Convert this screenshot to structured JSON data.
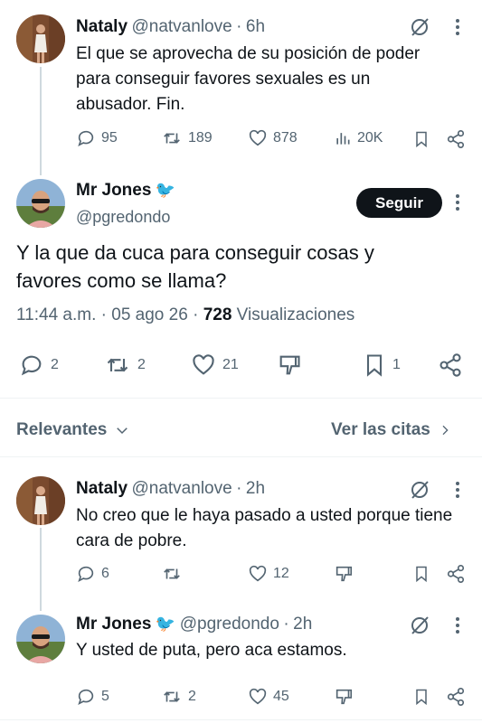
{
  "tweet1": {
    "name": "Nataly",
    "handle": "@natvanlove",
    "time": "6h",
    "text": "El que se aprovecha de su posición de poder para conseguir favores sexuales es un abusador. Fin.",
    "replies": "95",
    "retweets": "189",
    "likes": "878",
    "views": "20K"
  },
  "main_tweet": {
    "name": "Mr Jones",
    "name_emoji": "🐦",
    "handle": "@pgredondo",
    "follow_label": "Seguir",
    "text": "Y la que da cuca para conseguir cosas y favores como se llama?",
    "time": "11:44 a.m.",
    "date": "05 ago 26",
    "views_count": "728",
    "views_label": "Visualizaciones",
    "replies": "2",
    "retweets": "2",
    "likes": "21",
    "bookmarks": "1"
  },
  "replies_header": {
    "sort_label": "Relevantes",
    "quotes_label": "Ver las citas"
  },
  "reply1": {
    "name": "Nataly",
    "handle": "@natvanlove",
    "time": "2h",
    "text": "No creo que le haya pasado a usted porque tiene cara de pobre.",
    "replies": "6",
    "likes": "12"
  },
  "reply2": {
    "name": "Mr Jones",
    "name_emoji": "🐦",
    "handle": "@pgredondo",
    "time": "2h",
    "text": "Y usted de puta, pero aca estamos.",
    "replies": "5",
    "retweets": "2",
    "likes": "45"
  },
  "colors": {
    "text": "#0f1419",
    "muted": "#536471",
    "line": "#cfd9de",
    "bird": "#1d9bf0"
  }
}
